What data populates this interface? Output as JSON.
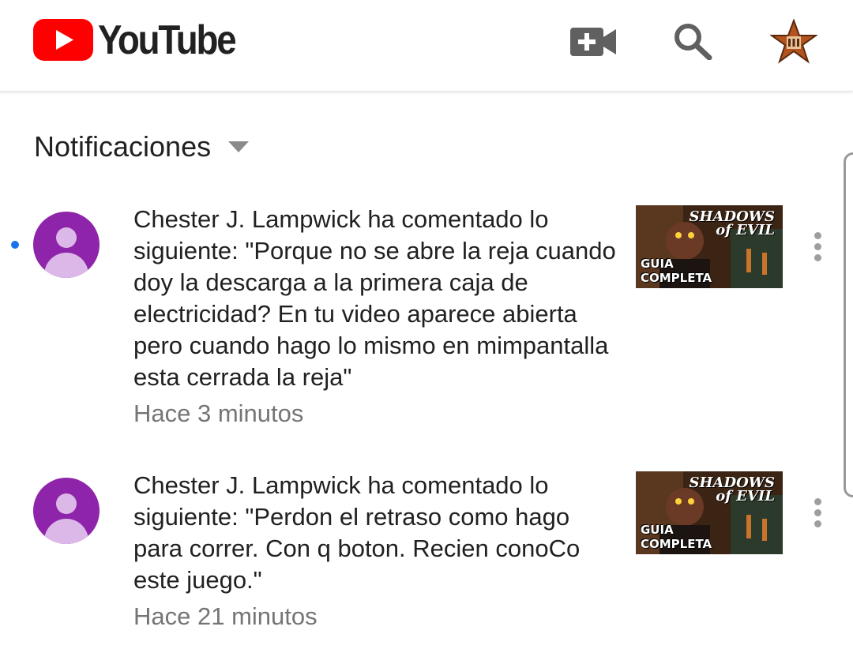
{
  "header": {
    "brand": "YouTube",
    "icons": [
      "youtube-logo-icon",
      "video-add-icon",
      "search-icon",
      "account-avatar-icon"
    ],
    "brand_color": "#ff0000"
  },
  "section": {
    "title": "Notificaciones"
  },
  "notifications": [
    {
      "text": "Chester J. Lampwick ha comentado lo siguiente: \"Porque no se abre la reja cuando doy la descarga a la primera caja de electricidad? En tu video aparece abierta pero cuando hago lo mismo en mimpantalla esta cerrada la reja\"",
      "time": "Hace 3 minutos",
      "unread": true,
      "thumbnail": {
        "title_line1": "SHADOWS",
        "title_line2": "of EVIL",
        "caption_line1": "GUIA",
        "caption_line2": "COMPLETA"
      }
    },
    {
      "text": "Chester J. Lampwick ha comentado lo siguiente: \"Perdon el retraso como hago para correr. Con q boton. Recien conoCo este juego.\"",
      "time": "Hace 21 minutos",
      "unread": false,
      "thumbnail": {
        "title_line1": "SHADOWS",
        "title_line2": "of EVIL",
        "caption_line1": "GUIA",
        "caption_line2": "COMPLETA"
      }
    }
  ],
  "colors": {
    "unread_dot": "#1a73e8",
    "avatar": "#8e24aa",
    "time_text": "#757575"
  }
}
